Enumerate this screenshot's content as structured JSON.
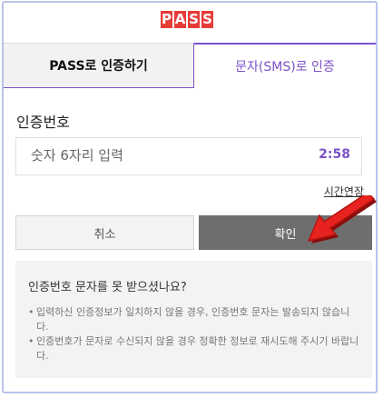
{
  "brand": {
    "logo_letters": [
      "P",
      "A",
      "S",
      "S"
    ],
    "color": "#e63c39"
  },
  "tabs": [
    {
      "label": "PASS로 인증하기",
      "active": false
    },
    {
      "label": "문자(SMS)로 인증",
      "active": true
    }
  ],
  "form": {
    "label": "인증번호",
    "placeholder": "숫자 6자리 입력",
    "timer": "2:58",
    "extend_label": "시간연장"
  },
  "buttons": {
    "cancel": "취소",
    "confirm": "확인"
  },
  "help": {
    "title": "인증번호 문자를 못 받으셨나요?",
    "items": [
      "입력하신 인증정보가 일치하지 않을 경우, 인증번호 문자는 발송되지 않습니다.",
      "인증번호가 문자로 수신되지 않을 경우 정확한 정보로 재시도해 주시기 바랍니다."
    ]
  },
  "colors": {
    "accent": "#7b52c7",
    "confirm_bg": "#6e6e6e",
    "arrow": "#e8231f"
  }
}
